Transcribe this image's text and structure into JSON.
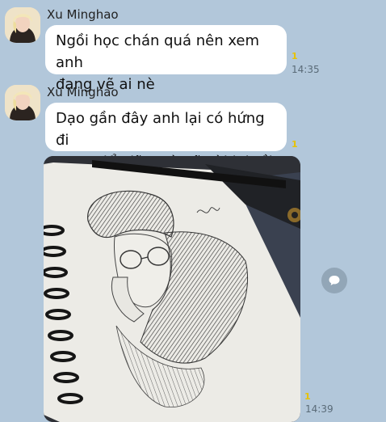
{
  "messages": [
    {
      "sender": "Xu Minghao",
      "lines": [
        "Ngồi học chán quá nên xem anh",
        "đang vẽ ai nè"
      ],
      "unread": "1",
      "time": "14:35"
    },
    {
      "sender": "Xu Minghao",
      "lines": [
        "Dạo gần đây anh lại có hứng đi",
        "xem triển lãm và vẽ vời lại rồi"
      ],
      "unread": "1"
    },
    {
      "sender": "Xu Minghao",
      "attachment": "pencil-sketch-photo",
      "unread": "1",
      "time": "14:39"
    }
  ],
  "icons": {
    "avatar": "avatar-icon",
    "share": "share-bubble-icon"
  },
  "colors": {
    "chat_background": "#b2c7da",
    "bubble": "#ffffff",
    "unread": "#e8c200",
    "time": "#5a6b78"
  }
}
